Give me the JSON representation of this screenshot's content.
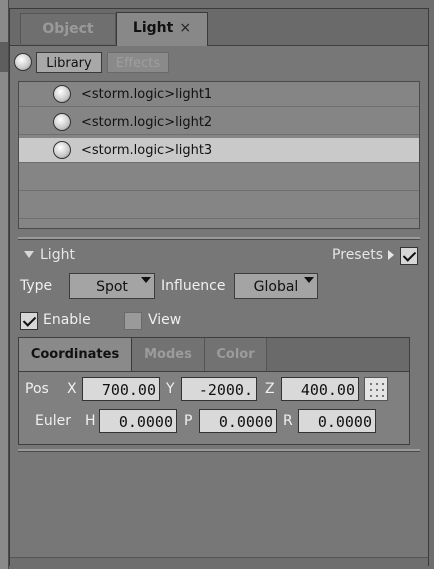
{
  "tabs": [
    {
      "label": "Object",
      "active": false
    },
    {
      "label": "Light",
      "active": true,
      "close": "×"
    }
  ],
  "toolbar": {
    "library_label": "Library",
    "effects_label": "Effects"
  },
  "lights": [
    {
      "label": "<storm.logic>light1",
      "selected": false
    },
    {
      "label": "<storm.logic>light2",
      "selected": false
    },
    {
      "label": "<storm.logic>light3",
      "selected": true
    }
  ],
  "section": {
    "title": "Light",
    "presets_label": "Presets",
    "presets_checked": true
  },
  "type": {
    "label": "Type",
    "value": "Spot"
  },
  "influence": {
    "label": "Influence",
    "value": "Global"
  },
  "enable": {
    "label": "Enable",
    "checked": true
  },
  "view": {
    "label": "View",
    "checked": false
  },
  "subtabs": [
    {
      "label": "Coordinates",
      "active": true
    },
    {
      "label": "Modes",
      "active": false
    },
    {
      "label": "Color",
      "active": false
    }
  ],
  "pos": {
    "label": "Pos",
    "x_label": "X",
    "x": "700.00",
    "y_label": "Y",
    "y": "-2000.",
    "z_label": "Z",
    "z": "400.00"
  },
  "euler": {
    "label": "Euler",
    "h_label": "H",
    "h": "0.0000",
    "p_label": "P",
    "p": "0.0000",
    "r_label": "R",
    "r": "0.0000"
  }
}
